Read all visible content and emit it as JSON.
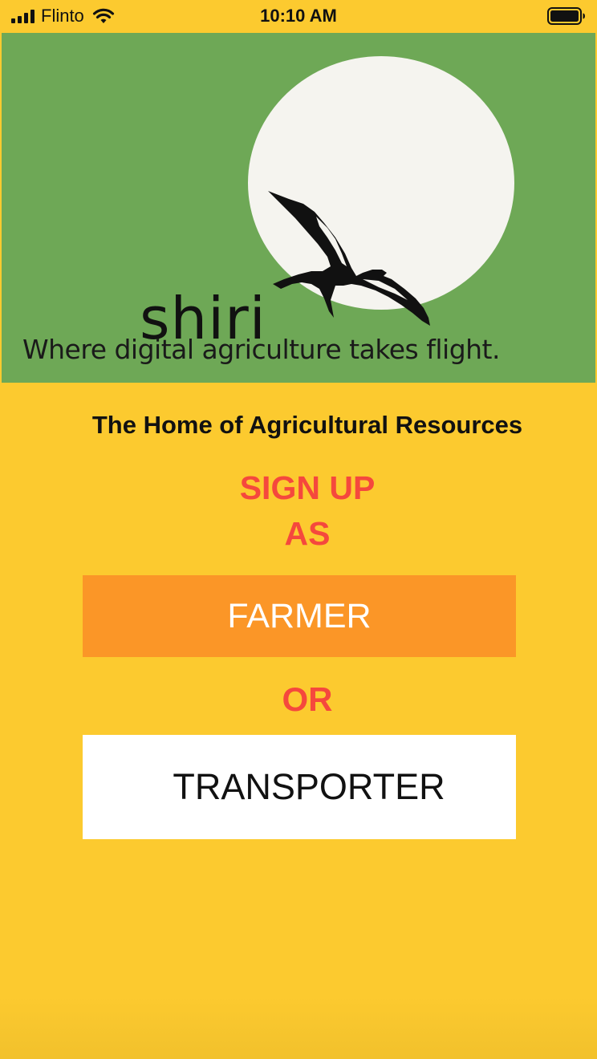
{
  "status_bar": {
    "carrier": "Flinto",
    "time": "10:10 AM",
    "signal_icon": "signal-bars-icon",
    "wifi_icon": "wifi-icon",
    "battery_icon": "battery-icon"
  },
  "banner": {
    "brand_name": "shiri",
    "tagline": "Where digital agriculture takes flight.",
    "logo_icon": "kite-bird-icon",
    "background_color": "#6ea856",
    "sun_color": "#f5f4ef"
  },
  "main": {
    "headline": "The Home of Agricultural Resources",
    "signup_line_1": "SIGN UP",
    "signup_line_2": "AS",
    "or_text": "OR",
    "farmer_button_label": "FARMER",
    "transporter_button_label": "TRANSPORTER"
  },
  "colors": {
    "background": "#fcca2f",
    "accent_red": "#f5483d",
    "farmer_button": "#fb9627",
    "transporter_button": "#ffffff"
  }
}
